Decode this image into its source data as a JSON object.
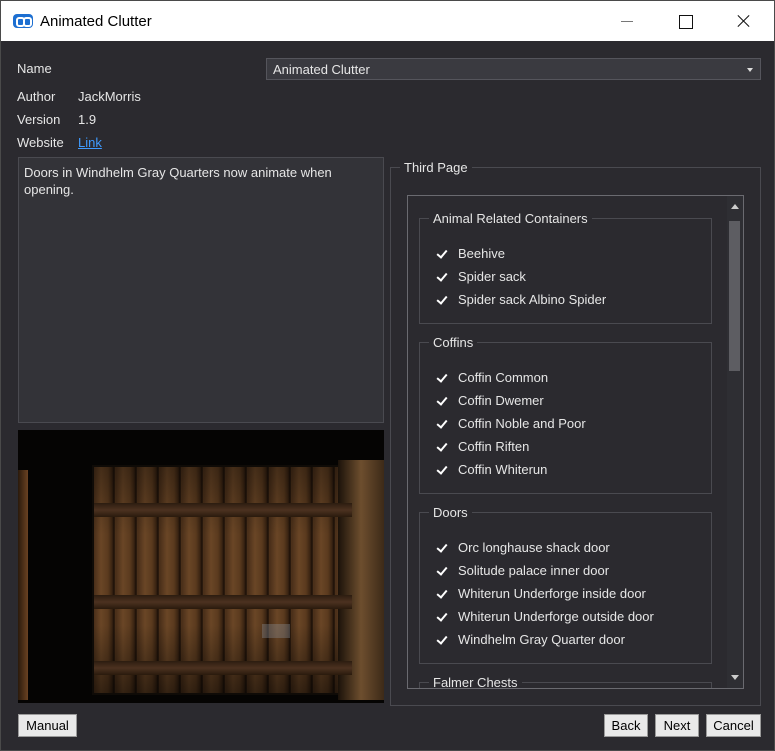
{
  "window": {
    "title": "Animated Clutter"
  },
  "info": {
    "name_label": "Name",
    "name_value": "Animated Clutter",
    "author_label": "Author",
    "author_value": "JackMorris",
    "version_label": "Version",
    "version_value": "1.9",
    "website_label": "Website",
    "website_link": "Link"
  },
  "description": "Doors in Windhelm Gray Quarters now animate when opening.",
  "page": {
    "title": "Third Page",
    "categories": [
      {
        "title": "Animal Related Containers",
        "items": [
          {
            "label": "Beehive",
            "checked": true
          },
          {
            "label": "Spider sack",
            "checked": true
          },
          {
            "label": "Spider sack Albino Spider",
            "checked": true
          }
        ]
      },
      {
        "title": "Coffins",
        "items": [
          {
            "label": "Coffin Common",
            "checked": true
          },
          {
            "label": "Coffin Dwemer",
            "checked": true
          },
          {
            "label": "Coffin Noble and Poor",
            "checked": true
          },
          {
            "label": "Coffin Riften",
            "checked": true
          },
          {
            "label": "Coffin Whiterun",
            "checked": true
          }
        ]
      },
      {
        "title": "Doors",
        "items": [
          {
            "label": "Orc longhause shack door",
            "checked": true
          },
          {
            "label": "Solitude palace inner door",
            "checked": true
          },
          {
            "label": "Whiterun Underforge inside door",
            "checked": true
          },
          {
            "label": "Whiterun Underforge outside door",
            "checked": true
          },
          {
            "label": "Windhelm Gray Quarter door",
            "checked": true
          }
        ]
      },
      {
        "title": "Falmer Chests",
        "items": []
      }
    ]
  },
  "buttons": {
    "manual": "Manual",
    "back": "Back",
    "next": "Next",
    "cancel": "Cancel"
  },
  "icons": {
    "app": "app-logo-icon",
    "minimize": "minimize-icon",
    "maximize": "maximize-icon",
    "close": "close-icon",
    "dropdown": "chevron-down-icon",
    "check": "checkmark-icon"
  },
  "colors": {
    "background": "#2b2a2f",
    "link": "#3f9bff",
    "accent": "#1d6fd1"
  }
}
